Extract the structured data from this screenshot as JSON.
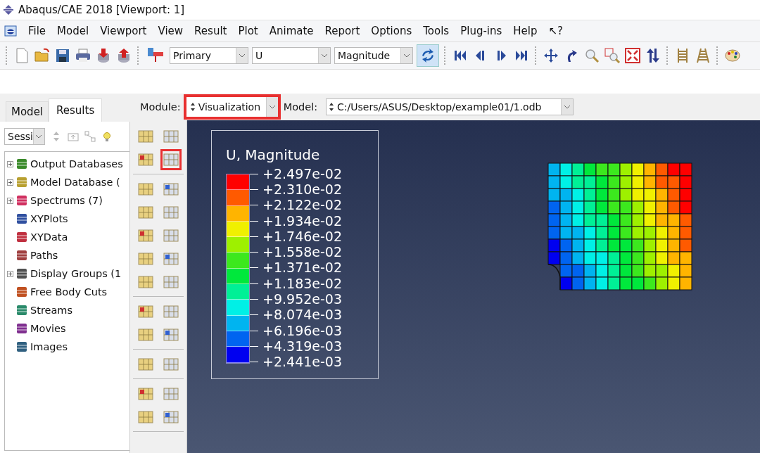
{
  "window": {
    "title": "Abaqus/CAE 2018 [Viewport: 1]"
  },
  "menu": [
    "File",
    "Model",
    "Viewport",
    "View",
    "Result",
    "Plot",
    "Animate",
    "Report",
    "Options",
    "Tools",
    "Plug-ins",
    "Help",
    "↖?"
  ],
  "toolbar": {
    "combos": [
      {
        "value": "Primary"
      },
      {
        "value": "U"
      },
      {
        "value": "Magnitude"
      }
    ]
  },
  "tabs": [
    {
      "label": "Model",
      "selected": false
    },
    {
      "label": "Results",
      "selected": true
    }
  ],
  "session_combo": {
    "value": "Sessi"
  },
  "tree": [
    {
      "label": "Output Databases",
      "expandable": true
    },
    {
      "label": "Model Database (",
      "expandable": true
    },
    {
      "label": "Spectrums (7)",
      "expandable": true
    },
    {
      "label": "XYPlots",
      "expandable": false
    },
    {
      "label": "XYData",
      "expandable": false
    },
    {
      "label": "Paths",
      "expandable": false
    },
    {
      "label": "Display Groups (1",
      "expandable": true
    },
    {
      "label": "Free Body Cuts",
      "expandable": false
    },
    {
      "label": "Streams",
      "expandable": false
    },
    {
      "label": "Movies",
      "expandable": false
    },
    {
      "label": "Images",
      "expandable": false
    }
  ],
  "module_bar": {
    "module_label": "Module:",
    "module": "Visualization",
    "module_highlighted": true,
    "model_label": "Model:",
    "model": "C:/Users/ASUS/Desktop/example01/1.odb"
  },
  "toolbox": {
    "tools": [
      {
        "highlighted": false
      },
      {
        "highlighted": false
      },
      {
        "highlighted": false
      },
      {
        "highlighted": true
      },
      {
        "highlighted": false
      },
      {
        "highlighted": false
      },
      {
        "highlighted": false
      },
      {
        "highlighted": false
      },
      {
        "highlighted": false
      },
      {
        "highlighted": false
      },
      {
        "highlighted": false
      },
      {
        "highlighted": false
      },
      {
        "highlighted": false
      },
      {
        "highlighted": false
      },
      {
        "highlighted": false
      },
      {
        "highlighted": false
      },
      {
        "highlighted": false
      },
      {
        "highlighted": false
      },
      {
        "highlighted": false
      },
      {
        "highlighted": false
      },
      {
        "highlighted": false
      },
      {
        "highlighted": false
      },
      {
        "highlighted": false
      },
      {
        "highlighted": false
      }
    ]
  },
  "legend": {
    "title": "U, Magnitude",
    "bands": [
      {
        "color": "#ff0000"
      },
      {
        "color": "#ff5a00"
      },
      {
        "color": "#ffb400"
      },
      {
        "color": "#f0f000"
      },
      {
        "color": "#9ef000"
      },
      {
        "color": "#3ce81e"
      },
      {
        "color": "#00e83c"
      },
      {
        "color": "#00f096"
      },
      {
        "color": "#00f0e6"
      },
      {
        "color": "#00b4f0"
      },
      {
        "color": "#0064f0"
      },
      {
        "color": "#0000f0"
      }
    ],
    "labels": [
      "+2.497e-02",
      "+2.310e-02",
      "+2.122e-02",
      "+1.934e-02",
      "+1.746e-02",
      "+1.558e-02",
      "+1.371e-02",
      "+1.183e-02",
      "+9.952e-03",
      "+8.074e-03",
      "+6.196e-03",
      "+4.319e-03",
      "+2.441e-03"
    ]
  }
}
